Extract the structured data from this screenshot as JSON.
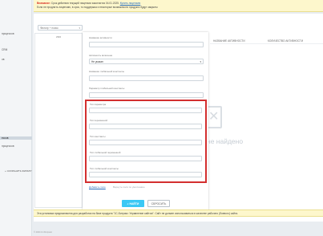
{
  "sidebar": {
    "items": [
      {
        "label": "процессов"
      },
      {
        "label": "CRM"
      },
      {
        "label": "ов"
      },
      {
        "label": "ессов"
      },
      {
        "label": "процессов"
      }
    ]
  },
  "warning": {
    "label": "Внимание:",
    "text": "Срок действия текущей лицензии закончится 04.01.2025.",
    "link": "Купить лицензию",
    "text2": "Если не продлить лицензию, в срок, то поддержка и некоторые возможности продукта будут закрыты"
  },
  "search": {
    "placeholder": "Фильтр + поиск"
  },
  "list": {
    "header": "ИМЯ",
    "add_group": "+ СОХРАНИТЬ ФИЛЬТР"
  },
  "table": {
    "col_name": "НАЗВАНИЕ АКТИВНОСТИ",
    "col_count": "КОЛИЧЕСТВО АКТИВНОСТИ"
  },
  "empty_state": {
    "text": "не найдено"
  },
  "form": {
    "fields": [
      {
        "label": "Название активности"
      },
      {
        "label": "Активность включена",
        "value": "Не указан"
      },
      {
        "label": "Название глобальной константы"
      },
      {
        "label": "Параметр глобальной константы"
      }
    ],
    "highlighted_fields": [
      {
        "label": "Тип параметра"
      },
      {
        "label": "Тип переменной"
      },
      {
        "label": "Тип константы"
      },
      {
        "label": "Тип глобальной переменной"
      },
      {
        "label": "Тип глобальной константы"
      }
    ],
    "add_field_link": "Добавить поле",
    "add_field_hint": "Вернуть поля по умолчанию",
    "find_button": "НАЙТИ",
    "reset_button": "СБРОСИТЬ"
  },
  "bottom_notice": {
    "text": "Эта установка предназначена для разработки на базе продукта \"1С-Битрикс: Управление сайтом\". Сайт не должен использоваться в качестве рабочего (боевого) сайта."
  },
  "footer": {
    "text": "© 2024 1С-Битрикс"
  }
}
